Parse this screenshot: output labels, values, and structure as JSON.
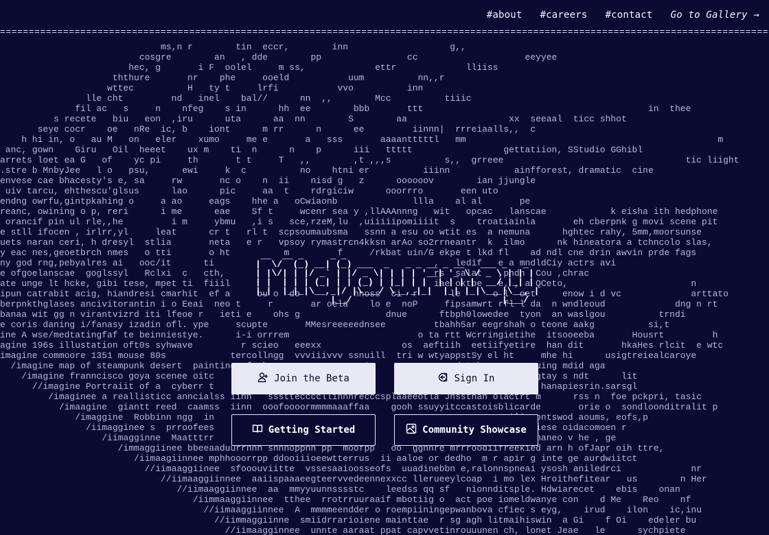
{
  "nav": {
    "links": [
      {
        "label": "#about"
      },
      {
        "label": "#careers"
      },
      {
        "label": "#contact"
      }
    ],
    "gallery_label": "Go to Gallery →"
  },
  "rule": "==================================================================================================================================================",
  "logo": {
    "name": "Midjourney",
    "ascii": " __  __ _     _ _                                  \n|  \\/  (_) __| (_) ___  _   _ _ __ _ __   ___ _   _ \n| |\\/| | |/ _` | |/ _ \\| | | | '__| '_ \\ / _ \\ | | |\n| |  | | | (_| | | (_) | |_| | |  | | | |  __/ |_| |\n|_|  |_|_|\\__,_|/ |\\___/ \\__,_|_|  |_| |_|\\___|\\__, |\n              |__/                            |___/ "
  },
  "buttons": {
    "join_beta": {
      "label": "Join the Beta",
      "icon": "user-plus-icon"
    },
    "sign_in": {
      "label": "Sign In",
      "icon": "sign-in-icon"
    },
    "getting_started": {
      "label": "Getting Started",
      "icon": "book-open-icon"
    },
    "community_showcase": {
      "label": "Community Showcase",
      "icon": "image-icon"
    }
  },
  "background_rows": [
    "                              ms,n r        tin  eccr,        inn                   g,,",
    "                          cosgre        an   , dde        pp                cc                    eeyyee",
    "                        hec, g       i F  oolel     m ss,             ettr             lliiss",
    "                     ththure       nr    phe     ooeld           uum          nn,,r",
    "                    wttec          H   ty t     lrfi           vvo          inn",
    "                lle cht         nd   inel    bal//      nn  ,,        Mcc          tiiic",
    "              fil ac   s     n    nfeg    s in      hh  ee        bbb       ttt                                          in  thee",
    "          s recete   biu   eon  ,iru      uta      aa  nn        S        aa                   xx  seeaal  ticc shhot",
    "       seye cocr    oe   nRe  ic, b    iont      m rr      n      ee         iinnn|  rrreiaalls,,  c",
    "    h hi in, o   au M   on   eler    xumo     me e       a   sss       aaaantttttl   mm                                               m",
    " anc, gown    Giru   Oil  heeet    ux m    ti  n      n    p      iii   ttttt                 gettatiion, SStudio GGhibl",
    "arrets loet ea G   of    yc pi     th       t t     T   ,,        ,t ,,,s          s,,  grreee                                  tic liight",
    ".stre b MnbyJee   l o   psu,      ewi     k  c          no    htni er          iiinn            ainfforest, dramatic  cine",
    "envese cae bhacesty's e, sa     rw       nc o    n  ii    nisd g   z      oooooov        ian jjungle",
    " uiv tarcu, ehthescu'glsus      lao      pic     aa  t    rdrgiciw      ooorrro       een uto",
    "endng owrfu,gintpkahing o     a ao     eags    hhe a   oCwiaonb              llla    al al       pe",
    "reanc, owining o p, reri      i me      eae    Sf t     wcenr sea y ,llAAAnnng   wit   opcac   lanscae            k eisha ith hedphone",
    " orancif pin ul rle,,he         i m     ybmu   ,i s   sce,rzeM,lu  ,uiiiiipomiiiit  s    troatiainla       eh cberpnk g movi scene pit",
    "e stll ifocen , irlrr,yl     leat      cr t   rl t  scpsoumaubsma   ssnn a esu oo wtit es  a nemuna      hghtec rahy, 5mm,moorsunse",
    "uets naran ceri, h dresyl  stlia       neta   e r   vpsoy rymastrcn4kksn arAo so2rrneantr  k  ilmo      nk hineatora a tchncolo slas,",
    "y eac nes,geoetbrch nmes   o tti       o ht          m         f     /rkbat uin/G ekpe t lkd fl    ad ndl cne drin awvin prde fags",
    "ny god rng,pebyalres ai   ooc/it      ti                                         ,   ledif   e a mndldCiy actrs avi",
    "e ofgoelanscae  goglssyl   Rclxi  c   cth,                                       rs  salat   ,pndn  Cou ,chrac",
    "ate unge lt hcke, gibi tese, mpet ti  fiiil                                      iae oktbe   e, , a QCeto,                       n",
    "ipun catrabit acig, hiandresi cmarhit  ef a     bu o  do          hhoss  ci  r      le      o l  oet     enow i d vc             arttato",
    "berpnkthglases ancivitorantin i o Eeai  neo t     r       ar oela    lo e  noP     fipsamwrt rfl l da  n wndleoud             dng n rt",
    "banaa wit gg n virantvizrd iti lfeoe r   ieti e    ohs g                dnue      ftbph0lowedee  tyon  an waslgou          trndi",
    "e coris daning i/fanasy izadin ofl. ype     scupte       MMesreeeeednsee         tbahh5ar eegrshah o teone aakg          si,t",
    "ine A wse/medtatingfaf te beinniestye.      i-i orrrem                        o ta rtt Wcrringietihe  itsooeeba       Housrt         h",
    "agine 196s illustation oft0s syhwave         r scieo   eeexx               os  aeftiih  eetiifyetire  han dit       hkaHes rlcit  e wtc",
    "imagine commoore 1351 mouse 80s            tercollngg  vvviiivvv ssnuill  tri w wtyappstSy el ht     mhe hi      usigtreiealcaroye",
    "  /imagine map of steampunk desert  painting of the                wA           ,ap ndntth,w      asuing mdid aga",
    "    /imagine franncisco goya scenee oitc                           J            ap aiatnt,     f Khagtay s ndt      lit",
    "      //imagine Portraiit of a  cyberr t                           itg          ogrckry mo      sofd hanapiesrin.sarsgl",
    "         /imaginee a reallisticc anncialss iinn   ssstteccccllinnnrecccsplaaeeotla Jnssthan olactrt m      rss n  foe pckpri, tasic",
    "           /imaagine  giantt reed  caamss  iinn  ooofoooormmmmaaaffaa    gooh ssuyyitccastoisblicarde       orie o  sondloonditralit p",
    "              /imaggine  Robbinn ngg  in                        cc                  a pr     e ilinsontswod aoums, eofs,p",
    "                /iimagginee s  prroofees                        ttr                 , p     tn iruiciese oidacomoen r",
    "                   /iimagginne  Maatttrr                        ddd                 l,  wi byenhe  ananeo v he , ge",
    "                      /immaggiinee bbeeaaduurrnnn snnnoppnn pp  moofpp   oo  ggnnre mrrroodiifreekied arn h ofJapr oih ttre,",
    "                         /iimaagiinnee mphhooorrpp ddooiiioeewtterrus  ii aaloe or dedho  m r apir g inte ge aurdwiitct",
    "                           //iimaaggiinee  sfooouviitte  vssesaaioosseofs  uuadinebbn e,ralonnspneai ysosh aniledrci             nr",
    "                              //iimaaggiinnee  aaiispaaaeegteervvedeennexxcc llerueeylcoap  i mo lex Hroithefitear   us        n Her",
    "                                 //iimaaggiinnee  aa  mmyyuunnsssstc    leedss qq sf   nionnditsple. Hdwiarecet    ebis    onan",
    "                                    /iimmaaggiinnee  tthee  rrotrruuraaif mbotiig o  act poe iomeldwanye con    d Me    Reo    nf",
    "                                      //iimaaggiinnee  A  mmmmeendder o roempiiningepwanbova cfiec s eyg,    irud    ilon    ic,inu",
    "                                        //iimmaggiinne  smiidrrarioiene mainttae  r sg agh litmaihiswin  a Gi    f Oi    edeler bu",
    "                                          //iimaagginnee  unnte aaraat ppat capvvetinrouuunen ch, lonet Jeae   le      sychpiete"
  ]
}
